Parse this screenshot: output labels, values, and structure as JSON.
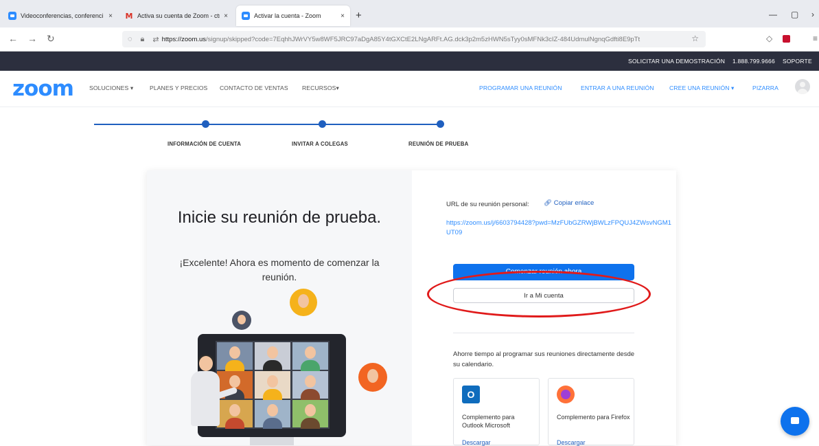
{
  "browser": {
    "tabs": [
      {
        "label": "Videoconferencias, conferenci",
        "icon": "zoom-favicon"
      },
      {
        "label": "Activa su cuenta de Zoom - ctr",
        "icon": "gmail-favicon"
      },
      {
        "label": "Activar la cuenta - Zoom",
        "icon": "zoom-favicon"
      }
    ],
    "tab_close": "×",
    "new_tab": "+",
    "window_controls": [
      "—",
      "▢",
      "›"
    ],
    "url_domain": "https://zoom.us",
    "url_rest": "/signup/skipped?code=7EqhhJWrVY5w8WF5JRC97aDgA85Y4tGXCtE2LNgARFt.AG.dck3p2m5zHWN5sTyy0sMFNk3cIZ-484UdmulNgnqGdfti8E9pTt"
  },
  "topbar": {
    "demo": "SOLICITAR UNA DEMOSTRACIÓN",
    "phone": "1.888.799.9666",
    "support": "SOPORTE"
  },
  "nav": {
    "logo": "zoom",
    "left": [
      "SOLUCIONES ▾",
      "PLANES Y PRECIOS",
      "CONTACTO DE VENTAS",
      "RECURSOS▾"
    ],
    "right": [
      "PROGRAMAR UNA REUNIÓN",
      "ENTRAR A UNA REUNIÓN",
      "CREE UNA REUNIÓN ▾",
      "PIZARRA"
    ]
  },
  "steps": [
    "INFORMACIÓN DE CUENTA",
    "INVITAR A COLEGAS",
    "REUNIÓN DE PRUEBA"
  ],
  "left_panel": {
    "headline": "Inicie su reunión de prueba.",
    "subtext": "¡Excelente! Ahora es momento de comenzar la reunión."
  },
  "right_panel": {
    "url_label": "URL de su reunión personal:",
    "copy_link": "Copiar enlace",
    "meeting_url": "https://zoom.us/j/6603794428?pwd=MzFUbGZRWjBWLzFPQUJ4ZWsvNGM1UT09",
    "start_button": "Comenzar reunión ahora",
    "account_button": "Ir a Mi cuenta",
    "save_time": "Ahorre tiempo al programar sus reuniones directamente desde su calendario.",
    "addons": [
      {
        "name": "Complemento para Outlook Microsoft",
        "download": "Descargar",
        "icon": "outlook-icon"
      },
      {
        "name": "Complemento para Firefox",
        "download": "Descargar",
        "icon": "firefox-icon"
      }
    ]
  },
  "colors": {
    "brand_blue": "#2d8cff",
    "button_blue": "#0e72ed",
    "dark_bar": "#2c2f3e",
    "annotation_red": "#e01a1a"
  }
}
